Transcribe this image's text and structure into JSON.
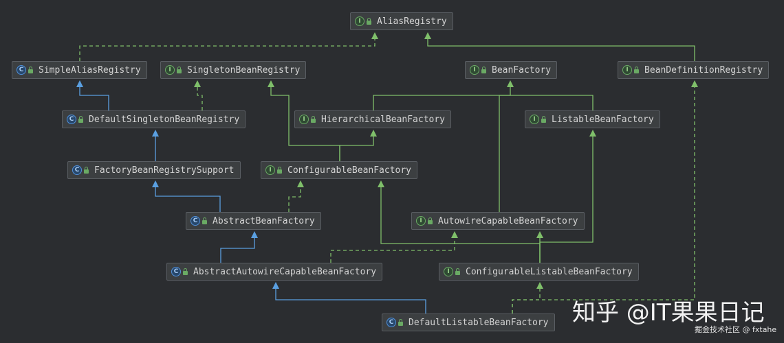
{
  "colors": {
    "background": "#2b2d30",
    "interface_edge": "#7fbf6a",
    "class_edge": "#5a9fe0"
  },
  "nodes": {
    "alias_registry": {
      "label": "AliasRegistry",
      "kind": "interface"
    },
    "simple_alias_registry": {
      "label": "SimpleAliasRegistry",
      "kind": "class"
    },
    "singleton_bean_registry": {
      "label": "SingletonBeanRegistry",
      "kind": "interface"
    },
    "bean_factory": {
      "label": "BeanFactory",
      "kind": "interface"
    },
    "bean_definition_registry": {
      "label": "BeanDefinitionRegistry",
      "kind": "interface"
    },
    "default_singleton_bean_registry": {
      "label": "DefaultSingletonBeanRegistry",
      "kind": "class"
    },
    "hierarchical_bean_factory": {
      "label": "HierarchicalBeanFactory",
      "kind": "interface"
    },
    "listable_bean_factory": {
      "label": "ListableBeanFactory",
      "kind": "interface"
    },
    "factory_bean_registry_support": {
      "label": "FactoryBeanRegistrySupport",
      "kind": "abstract-class"
    },
    "configurable_bean_factory": {
      "label": "ConfigurableBeanFactory",
      "kind": "interface"
    },
    "abstract_bean_factory": {
      "label": "AbstractBeanFactory",
      "kind": "abstract-class"
    },
    "autowire_capable_bean_factory": {
      "label": "AutowireCapableBeanFactory",
      "kind": "interface"
    },
    "abstract_autowire_capable_bean_factory": {
      "label": "AbstractAutowireCapableBeanFactory",
      "kind": "abstract-class"
    },
    "configurable_listable_bean_factory": {
      "label": "ConfigurableListableBeanFactory",
      "kind": "interface"
    },
    "default_listable_bean_factory": {
      "label": "DefaultListableBeanFactory",
      "kind": "class"
    }
  },
  "icons": {
    "interface": "I",
    "class": "C",
    "abstract-class": "C"
  },
  "edges": [
    {
      "from": "simple_alias_registry",
      "to": "alias_registry",
      "type": "implements"
    },
    {
      "from": "default_singleton_bean_registry",
      "to": "simple_alias_registry",
      "type": "extends"
    },
    {
      "from": "default_singleton_bean_registry",
      "to": "singleton_bean_registry",
      "type": "implements"
    },
    {
      "from": "factory_bean_registry_support",
      "to": "default_singleton_bean_registry",
      "type": "extends"
    },
    {
      "from": "abstract_bean_factory",
      "to": "factory_bean_registry_support",
      "type": "extends"
    },
    {
      "from": "abstract_bean_factory",
      "to": "configurable_bean_factory",
      "type": "implements"
    },
    {
      "from": "configurable_bean_factory",
      "to": "singleton_bean_registry",
      "type": "interface-extends"
    },
    {
      "from": "configurable_bean_factory",
      "to": "hierarchical_bean_factory",
      "type": "interface-extends"
    },
    {
      "from": "hierarchical_bean_factory",
      "to": "bean_factory",
      "type": "interface-extends"
    },
    {
      "from": "listable_bean_factory",
      "to": "bean_factory",
      "type": "interface-extends"
    },
    {
      "from": "autowire_capable_bean_factory",
      "to": "bean_factory",
      "type": "interface-extends"
    },
    {
      "from": "bean_definition_registry",
      "to": "alias_registry",
      "type": "interface-extends"
    },
    {
      "from": "abstract_autowire_capable_bean_factory",
      "to": "abstract_bean_factory",
      "type": "extends"
    },
    {
      "from": "abstract_autowire_capable_bean_factory",
      "to": "autowire_capable_bean_factory",
      "type": "implements"
    },
    {
      "from": "configurable_listable_bean_factory",
      "to": "listable_bean_factory",
      "type": "interface-extends"
    },
    {
      "from": "configurable_listable_bean_factory",
      "to": "autowire_capable_bean_factory",
      "type": "interface-extends"
    },
    {
      "from": "configurable_listable_bean_factory",
      "to": "configurable_bean_factory",
      "type": "interface-extends"
    },
    {
      "from": "default_listable_bean_factory",
      "to": "abstract_autowire_capable_bean_factory",
      "type": "extends"
    },
    {
      "from": "default_listable_bean_factory",
      "to": "configurable_listable_bean_factory",
      "type": "implements"
    },
    {
      "from": "default_listable_bean_factory",
      "to": "bean_definition_registry",
      "type": "implements"
    }
  ],
  "watermark": {
    "main": "知乎 @IT果果日记",
    "sub": "掘金技术社区 @ fxtahe"
  }
}
